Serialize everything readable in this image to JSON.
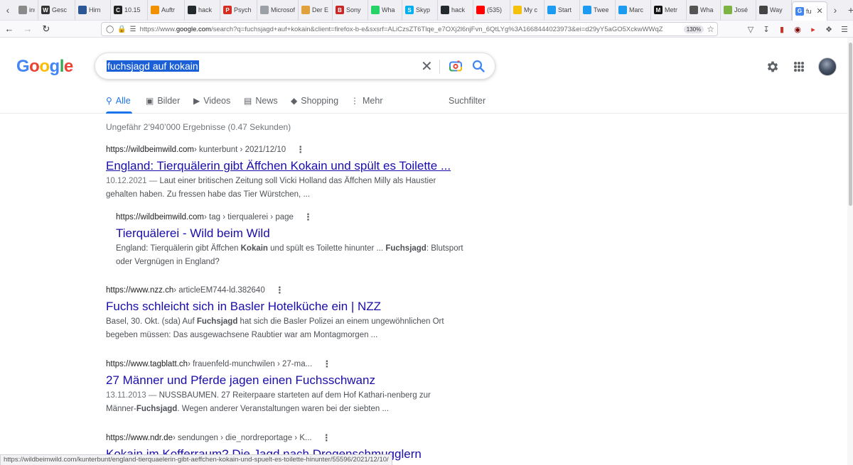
{
  "browser": {
    "tabs": [
      {
        "label": "inu",
        "icon": "tab-page-icon",
        "color": "#8a8a8a",
        "width": 32
      },
      {
        "label": "Gesc",
        "icon": "wikipedia-icon",
        "color": "#333333",
        "glyph": "W",
        "width": 52
      },
      {
        "label": "Hirn",
        "icon": "grid-site-icon",
        "color": "#2b5797",
        "width": 50
      },
      {
        "label": "10.15",
        "icon": "c-site-icon",
        "color": "#222222",
        "glyph": "C",
        "width": 52
      },
      {
        "label": "Auftr",
        "icon": "orange-site-icon",
        "color": "#f29100",
        "width": 52
      },
      {
        "label": "hack",
        "icon": "github-icon",
        "color": "#24292e",
        "width": 50
      },
      {
        "label": "Psych",
        "icon": "p-site-icon",
        "color": "#d62d20",
        "glyph": "P",
        "width": 52
      },
      {
        "label": "Microsof",
        "icon": "page-icon",
        "color": "#9aa0a6",
        "width": 58
      },
      {
        "label": "Der E",
        "icon": "orange-site-icon",
        "color": "#e0a03c",
        "width": 48
      },
      {
        "label": "Sony",
        "icon": "b-site-icon",
        "color": "#c62828",
        "glyph": "B",
        "width": 50
      },
      {
        "label": "Wha",
        "icon": "whatsapp-icon",
        "color": "#25d366",
        "width": 48
      },
      {
        "label": "Skyp",
        "icon": "skype-icon",
        "color": "#00aff0",
        "glyph": "S",
        "width": 50
      },
      {
        "label": "hack",
        "icon": "github-icon",
        "color": "#24292e",
        "width": 50
      },
      {
        "label": "(535)",
        "icon": "youtube-icon",
        "color": "#ff0000",
        "width": 52
      },
      {
        "label": "My c",
        "icon": "yellow-site-icon",
        "color": "#f4c20d",
        "width": 48
      },
      {
        "label": "Start",
        "icon": "twitter-icon",
        "color": "#1d9bf0",
        "width": 50
      },
      {
        "label": "Twee",
        "icon": "twitter-icon",
        "color": "#1d9bf0",
        "width": 50
      },
      {
        "label": "Marc",
        "icon": "twitter-icon",
        "color": "#1d9bf0",
        "width": 50
      },
      {
        "label": "Metr",
        "icon": "medium-icon",
        "color": "#111111",
        "glyph": "M",
        "width": 50
      },
      {
        "label": "Wha",
        "icon": "drop-site-icon",
        "color": "#555555",
        "width": 48
      },
      {
        "label": "José",
        "icon": "check-site-icon",
        "color": "#7cb342",
        "width": 50
      },
      {
        "label": "Way",
        "icon": "wayback-icon",
        "color": "#444444",
        "width": 50
      },
      {
        "label": "fu",
        "icon": "google-icon",
        "color": "#4285f4",
        "glyph": "G",
        "width": 50,
        "active": true
      }
    ],
    "url_prefix": "https://www.",
    "url_domain": "google.com",
    "url_rest": "/search?q=fuchsjagd+auf+kokain&client=firefox-b-e&sxsrf=ALiCzsZT6Tlqe_e7OXj2l6njFvn_6QtLYg%3A1668444023973&ei=d29yY5aGO5XckwWWqZ",
    "zoom": "130%",
    "status_url": "https://wildbeimwild.com/kunterbunt/england-tierquaelerin-gibt-aeffchen-kokain-und-spuelt-es-toilette-hinunter/55596/2021/12/10/"
  },
  "google": {
    "logo_letters": [
      {
        "ch": "G",
        "color": "#4285f4"
      },
      {
        "ch": "o",
        "color": "#ea4335"
      },
      {
        "ch": "o",
        "color": "#fbbc05"
      },
      {
        "ch": "g",
        "color": "#4285f4"
      },
      {
        "ch": "l",
        "color": "#34a853"
      },
      {
        "ch": "e",
        "color": "#ea4335"
      }
    ],
    "query": "fuchsjagd auf kokain",
    "tabs": {
      "alle": "Alle",
      "bilder": "Bilder",
      "videos": "Videos",
      "news": "News",
      "shopping": "Shopping",
      "mehr": "Mehr",
      "suchfilter": "Suchfilter"
    },
    "stats": "Ungefähr 2’940’000 Ergebnisse (0.47 Sekunden)",
    "results": [
      {
        "site": "https://wildbeimwild.com",
        "path": " › kunterbunt › 2021/12/10",
        "title": "England: Tierquälerin gibt Äffchen Kokain und spült es Toilette ...",
        "date": "10.12.2021 — ",
        "snippet_l1": "Laut einer britischen Zeitung soll Vicki Holland das Äffchen Milly als Haustier",
        "snippet_l2": "gehalten haben. Zu fressen habe das Tier Würstchen, ..."
      },
      {
        "site": "https://wildbeimwild.com",
        "path": " › tag › tierqualerei › page",
        "title": "Tierquälerei - Wild beim Wild",
        "s_a": "England: Tierquälerin gibt Äffchen ",
        "s_b": "Kokain",
        "s_c": " und spült es Toilette hinunter ... ",
        "s_d": "Fuchsjagd",
        "s_e": ": Blutsport",
        "snippet_l2": "oder Vergnügen in England?"
      },
      {
        "site": "https://www.nzz.ch",
        "path": " › articleEM744-ld.382640",
        "title": "Fuchs schleicht sich in Basler Hotelküche ein | NZZ",
        "s_a": "Basel, 30. Okt. (sda) Auf ",
        "s_b": "Fuchsjagd",
        "s_c": " hat sich die Basler Polizei an einem ungewöhnlichen Ort",
        "snippet_l2": "begeben müssen: Das ausgewachsene Raubtier war am Montagmorgen ..."
      },
      {
        "site": "https://www.tagblatt.ch",
        "path": " › frauenfeld-munchwilen › 27-ma...",
        "title": "27 Männer und Pferde jagen einen Fuchsschwanz",
        "date": "13.11.2013 — ",
        "snippet_l1": "NUSSBAUMEN. 27 Reiterpaare starteten auf dem Hof Kathari-nenberg zur",
        "s_a": "Männer-",
        "s_b": "Fuchsjagd",
        "s_c": ". Wegen anderer Veranstaltungen waren bei der siebten ..."
      },
      {
        "site": "https://www.ndr.de",
        "path": " › sendungen › die_nordreportage › K...",
        "title": "Kokain im Kofferraum? Die Jagd nach Drogenschmugglern"
      }
    ]
  }
}
